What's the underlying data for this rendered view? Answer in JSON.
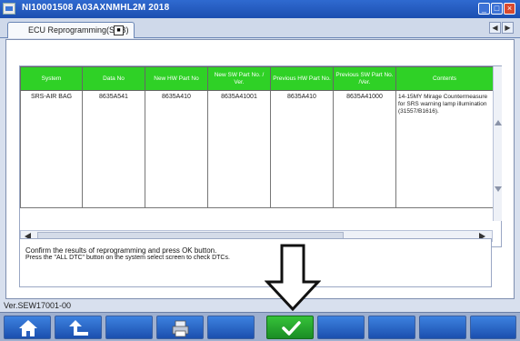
{
  "window": {
    "title": "NI10001508  A03AXNMHL2M 2018"
  },
  "tab": {
    "label": "ECU Reprogramming(SDB)"
  },
  "table": {
    "columns": [
      "System",
      "Data No",
      "New HW Part No",
      "New SW Part No. / Ver.",
      "Previous HW Part No.",
      "Previous SW Part No. /Ver.",
      "Contents"
    ],
    "rows": [
      {
        "system": "SRS-AIR BAG",
        "data_no": "8635A541",
        "new_hw": "8635A410",
        "new_sw": "8635A41001",
        "prev_hw": "8635A410",
        "prev_sw": "8635A41000",
        "contents": "14-15MY Mirage Countermeasure for SRS warning lamp illumination (31557/B1616)."
      }
    ]
  },
  "message": {
    "line1": "Confirm the results of reprogramming and press OK button.",
    "line2": "Press the \"ALL DTC\" button on the system select screen to check DTCs."
  },
  "version": "Ver.SEW17001-00",
  "toolbar": {
    "buttons": [
      {
        "name": "home-button",
        "icon": "home-icon"
      },
      {
        "name": "back-button",
        "icon": "back-arrow-icon"
      },
      {
        "name": "blank-button-1",
        "icon": ""
      },
      {
        "name": "print-button",
        "icon": "printer-icon"
      },
      {
        "name": "blank-button-2",
        "icon": ""
      },
      {
        "name": "ok-button",
        "icon": "check-icon"
      },
      {
        "name": "blank-button-3",
        "icon": ""
      },
      {
        "name": "blank-button-4",
        "icon": ""
      },
      {
        "name": "blank-button-5",
        "icon": ""
      },
      {
        "name": "blank-button-6",
        "icon": ""
      }
    ]
  },
  "colors": {
    "header_green": "#2fd126",
    "title_blue": "#1c4fb0",
    "ok_green": "#1a8d25"
  }
}
